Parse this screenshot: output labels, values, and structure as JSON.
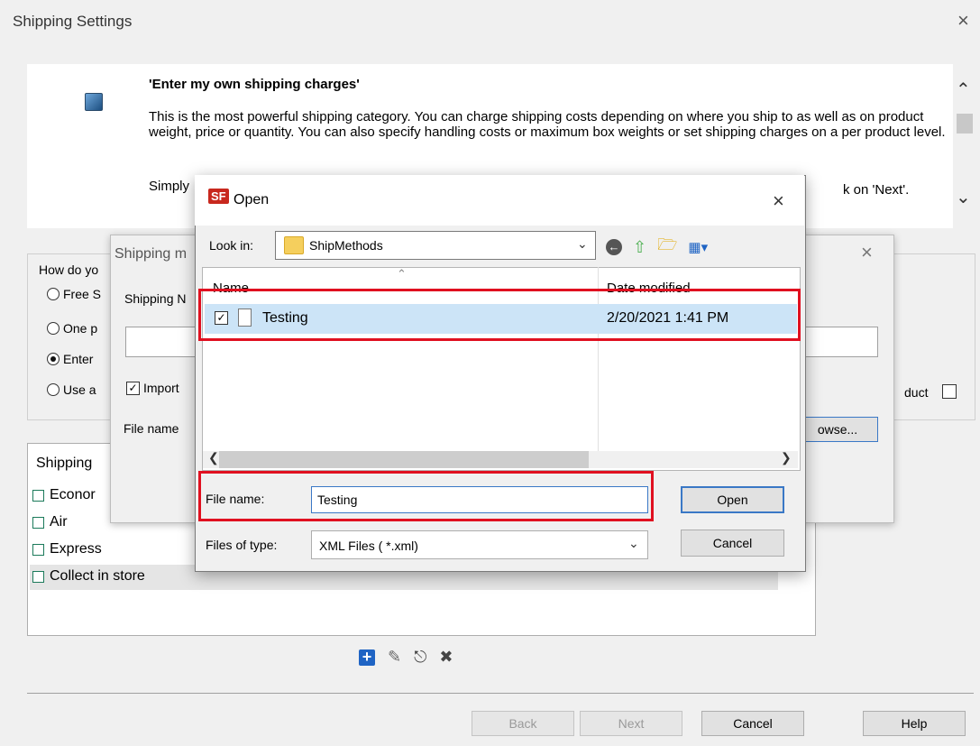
{
  "main": {
    "title": "Shipping Settings",
    "close_glyph": "×",
    "info": {
      "heading": "'Enter my own shipping charges'",
      "body": "This is the most powerful shipping category. You can charge shipping costs depending on where you ship to as well as on product weight, price or quantity. You can also specify handling costs or maximum box weights or set shipping charges on a per product level.",
      "simply": "Simply",
      "next_tail": "k on 'Next'."
    },
    "group_legend": "How do yo",
    "radios": [
      {
        "label": "Free S",
        "selected": false
      },
      {
        "label": "One p",
        "selected": false
      },
      {
        "label": "Enter",
        "selected": true
      },
      {
        "label": "Use a",
        "selected": false
      }
    ],
    "list_header": "Shipping",
    "list_items": [
      "Econor",
      "Air",
      "Express",
      "Collect in store"
    ],
    "buttons": {
      "back": "Back",
      "next": "Next",
      "cancel": "Cancel",
      "help": "Help"
    }
  },
  "shipping_dialog": {
    "title": "Shipping m",
    "close_glyph": "×",
    "method_label": "Shipping N",
    "import_label": "Import",
    "file_name_label": "File name",
    "browse_label": "owse...",
    "product_label": "duct"
  },
  "open_dialog": {
    "badge": "SF",
    "title": "Open",
    "close_glyph": "×",
    "look_in_label": "Look in:",
    "look_in_value": "ShipMethods",
    "columns": {
      "name": "Name",
      "date": "Date modified"
    },
    "files": [
      {
        "name": "Testing",
        "date_modified": "2/20/2021 1:41 PM",
        "checked": true
      }
    ],
    "file_name_label": "File name:",
    "file_name_value": "Testing",
    "files_of_type_label": "Files of type:",
    "files_of_type_value": "XML Files ( *.xml)",
    "open_button": "Open",
    "cancel_button": "Cancel"
  },
  "colors": {
    "highlight_box": "#e01020",
    "selection": "#cce4f7",
    "accent": "#3a78c6"
  }
}
